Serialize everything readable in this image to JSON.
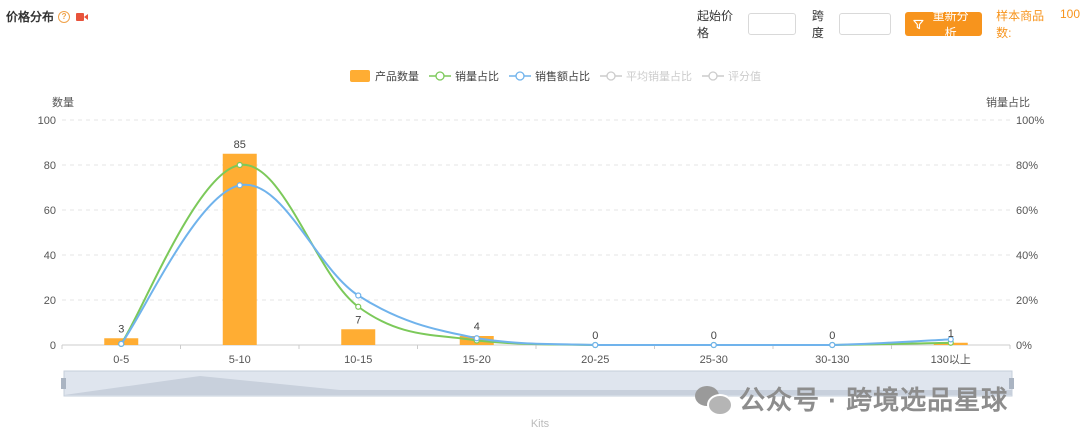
{
  "header": {
    "title": "价格分布",
    "help_glyph": "?"
  },
  "controls": {
    "start_price_label": "起始价格",
    "start_price_value": "",
    "span_label": "跨度",
    "span_value": "",
    "reanalyze_label": "重新分析",
    "sample_label": "样本商品数:",
    "sample_value": "100"
  },
  "chart_data": {
    "type": "bar",
    "categories": [
      "0-5",
      "5-10",
      "10-15",
      "15-20",
      "20-25",
      "25-30",
      "30-130",
      "130以上"
    ],
    "series": [
      {
        "name": "产品数量",
        "kind": "bar",
        "axis": "left",
        "values": [
          3,
          85,
          7,
          4,
          0,
          0,
          0,
          1
        ],
        "labels": [
          "3",
          "85",
          "7",
          "4",
          "0",
          "0",
          "0",
          "1"
        ],
        "color": "#ffad33"
      },
      {
        "name": "销量占比",
        "kind": "line",
        "axis": "right",
        "values": [
          0.5,
          80,
          17,
          2,
          0,
          0,
          0,
          1
        ],
        "color": "#7cc95a"
      },
      {
        "name": "销售额占比",
        "kind": "line",
        "axis": "right",
        "values": [
          0.5,
          71,
          22,
          3,
          0,
          0,
          0,
          2.5
        ],
        "color": "#70b3ec"
      },
      {
        "name": "平均销量占比",
        "kind": "line",
        "axis": "right",
        "values": [],
        "color": "#cccccc",
        "disabled": true
      },
      {
        "name": "评分值",
        "kind": "line",
        "axis": "right",
        "values": [],
        "color": "#cccccc",
        "disabled": true
      }
    ],
    "ylabel": "数量",
    "y2label": "销量占比",
    "ylim": [
      0,
      100
    ],
    "y2lim": [
      0,
      100
    ],
    "yticks": [
      "0",
      "20",
      "40",
      "60",
      "80",
      "100"
    ],
    "y2ticks": [
      "0%",
      "20%",
      "40%",
      "60%",
      "80%",
      "100%"
    ],
    "grid": true,
    "legend": "top-center",
    "xlabel": "Kits"
  },
  "watermark": {
    "text": "公众号 · 跨境选品星球"
  },
  "colors": {
    "accent": "#f7941d",
    "bar": "#ffad33",
    "green": "#7cc95a",
    "blue": "#70b3ec",
    "disabled": "#cccccc"
  }
}
